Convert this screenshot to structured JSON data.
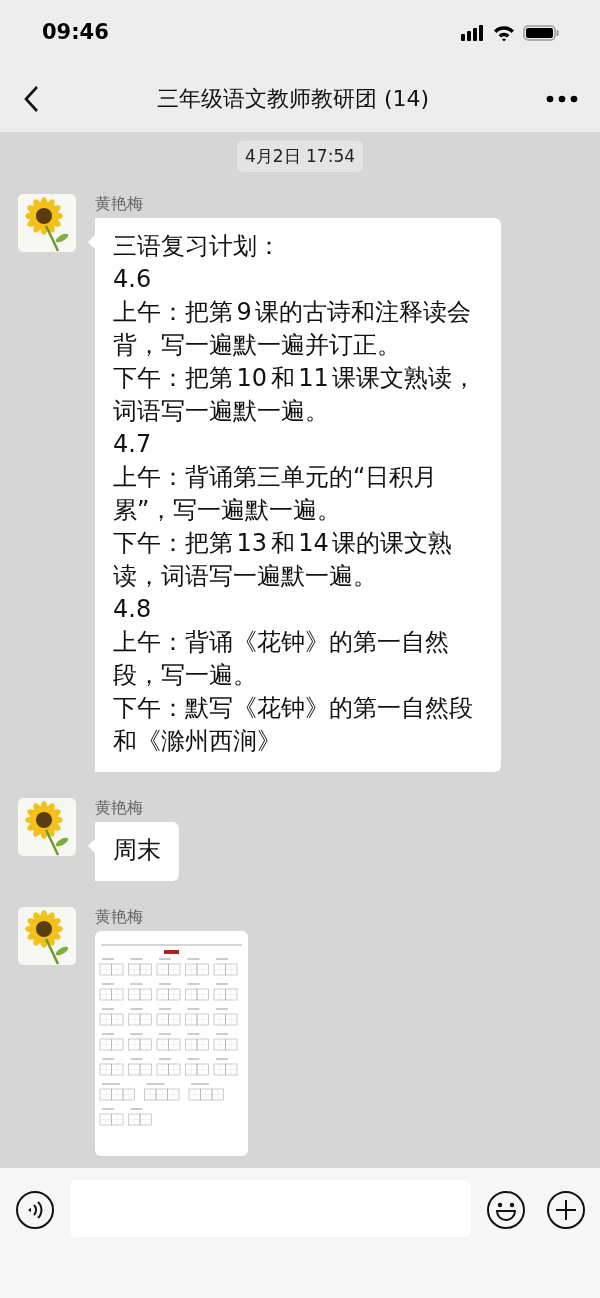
{
  "status_bar": {
    "time": "09:46"
  },
  "header": {
    "title": "三年级语文教师教研团 (14)"
  },
  "timestamp": "4月2日 17:54",
  "messages": [
    {
      "sender": "黄艳梅",
      "kind": "text",
      "paragraphs": [
        "三语复习计划：",
        "4.6",
        "上午：把第9课的古诗和注释读会背，写一遍默一遍并订正。",
        "下午：把第10和11课课文熟读，词语写一遍默一遍。",
        "4.7",
        "上午：背诵第三单元的“日积月累”，写一遍默一遍。",
        "下午：把第13和14课的课文熟读，词语写一遍默一遍。",
        "4.8",
        "上午：背诵《花钟》的第一自然段，写一遍。",
        "下午：默写《花钟》的第一自然段和《滁州西涧》"
      ]
    },
    {
      "sender": "黄艳梅",
      "kind": "text",
      "paragraphs": [
        "周末"
      ]
    },
    {
      "sender": "黄艳梅"
    }
  ]
}
